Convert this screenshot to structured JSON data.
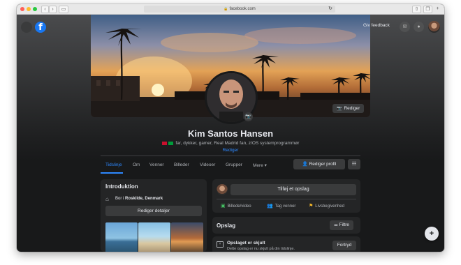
{
  "browser": {
    "url": "facebook.com",
    "nav_back": "‹",
    "nav_forward": "›"
  },
  "header": {
    "logo": "f",
    "feedback_label": "Giv feedback",
    "icons": [
      "messenger-icon",
      "notifications-icon"
    ]
  },
  "profile": {
    "cover_edit_label": "Rediger",
    "name": "Kim Santos Hansen",
    "bio": "far, dykker, gamer, Real Madrid fan, z/OS systemprogrammør",
    "bio_edit_label": "Rediger",
    "flags": [
      "#c8102e",
      "#009c3b"
    ]
  },
  "tabs": [
    {
      "label": "Tidslinje",
      "active": true
    },
    {
      "label": "Om"
    },
    {
      "label": "Venner"
    },
    {
      "label": "Billeder"
    },
    {
      "label": "Videoer"
    },
    {
      "label": "Grupper"
    },
    {
      "label": "Mere ▾"
    }
  ],
  "actions": {
    "edit_profile_label": "Rediger profil",
    "more_label": "☷"
  },
  "intro": {
    "title": "Introduktion",
    "location_prefix": "Bor i ",
    "location": "Roskilde, Denmark",
    "edit_details_label": "Rediger detaljer"
  },
  "composer": {
    "add_post_label": "Tilføj et opslag",
    "actions": [
      "Billede/video",
      "Tag venner",
      "Livsbegivenhed"
    ]
  },
  "posts": {
    "title": "Opslag",
    "filter_label": "Filtre",
    "hidden_title": "Opslaget er skjult",
    "hidden_sub": "Dette opslag er nu skjult på din tidslinje.",
    "undo_label": "Fortryd"
  },
  "fab_label": "+"
}
